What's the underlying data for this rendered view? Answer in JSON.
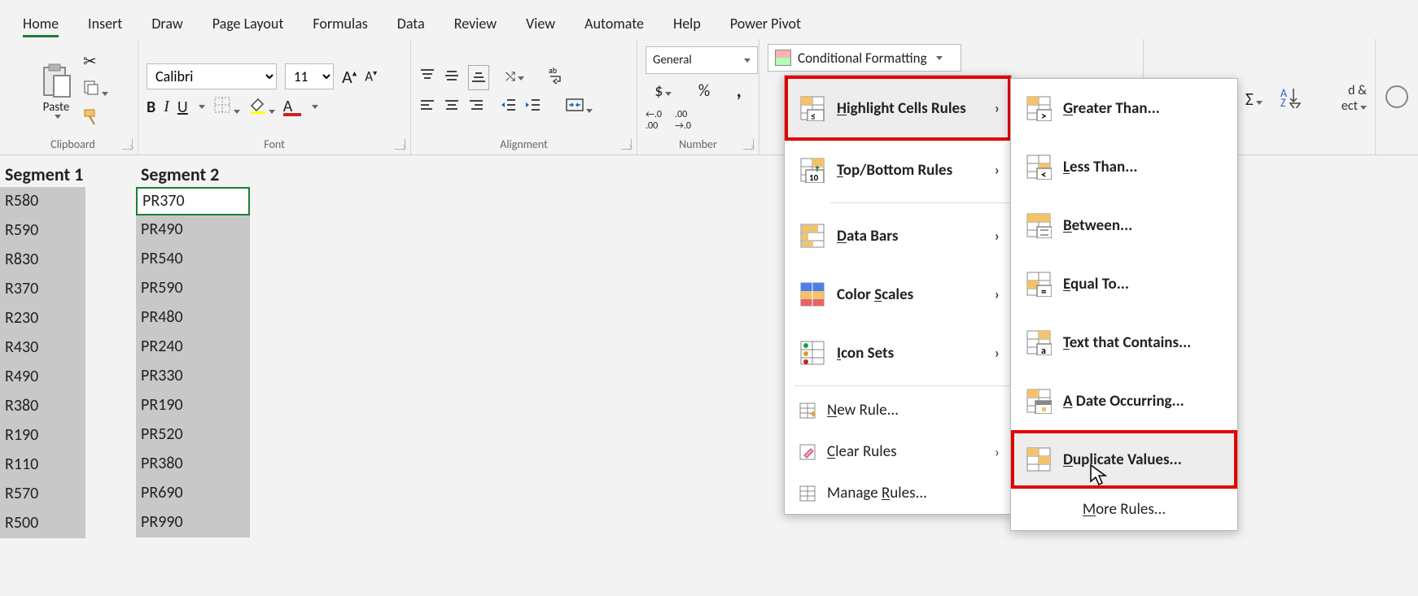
{
  "ribbon": {
    "tabs": [
      "Home",
      "Insert",
      "Draw",
      "Page Layout",
      "Formulas",
      "Data",
      "Review",
      "View",
      "Automate",
      "Help",
      "Power Pivot"
    ],
    "activeTab": "Home",
    "clipboard": {
      "label": "Clipboard",
      "paste": "Paste"
    },
    "font": {
      "label": "Font",
      "name": "Calibri",
      "size": "11",
      "bold": "B",
      "italic": "I",
      "underline": "U",
      "incA": "A",
      "decA": "A"
    },
    "alignment": {
      "label": "Alignment"
    },
    "number": {
      "label": "Number",
      "format": "General",
      "dollar": "$",
      "percent": "%",
      "comma": ",",
      "incDec": ".0",
      "decInc": ".00"
    },
    "condfmt": {
      "label": "Conditional Formatting"
    },
    "insert": "Insert",
    "autosum": "Σ",
    "rightPartial": {
      "a": "d &",
      "b": "ect"
    }
  },
  "sheet": {
    "headers": [
      "Segment 1",
      "Segment 2"
    ],
    "colA": [
      "R580",
      "R590",
      "R830",
      "R370",
      "R230",
      "R430",
      "R490",
      "R380",
      "R190",
      "R110",
      "R570",
      "R500"
    ],
    "colB": [
      "PR370",
      "PR490",
      "PR540",
      "PR590",
      "PR480",
      "PR240",
      "PR330",
      "PR190",
      "PR520",
      "PR380",
      "PR690",
      "PR990"
    ]
  },
  "menu1": {
    "items": [
      {
        "label": "Highlight Cells Rules",
        "sub": true,
        "highlight": true,
        "ak": "H"
      },
      {
        "label": "Top/Bottom Rules",
        "sub": true,
        "ak": "T"
      },
      {
        "label": "Data Bars",
        "sub": true,
        "ak": "D"
      },
      {
        "label": "Color Scales",
        "sub": true,
        "ak": "S"
      },
      {
        "label": "Icon Sets",
        "sub": true,
        "ak": "I"
      },
      {
        "label": "New Rule...",
        "sub": false,
        "ak": "N"
      },
      {
        "label": "Clear Rules",
        "sub": true,
        "ak": "C"
      },
      {
        "label": "Manage Rules...",
        "sub": false,
        "ak": "R"
      }
    ]
  },
  "menu2": {
    "items": [
      {
        "label": "Greater Than...",
        "ak": "G"
      },
      {
        "label": "Less Than...",
        "ak": "L"
      },
      {
        "label": "Between...",
        "ak": "B"
      },
      {
        "label": "Equal To...",
        "ak": "E"
      },
      {
        "label": "Text that Contains...",
        "ak": "T"
      },
      {
        "label": "A Date Occurring...",
        "ak": "A"
      },
      {
        "label": "Duplicate Values...",
        "ak": "D",
        "highlight": true
      },
      {
        "label": "More Rules...",
        "ak": "M",
        "plain": true
      }
    ]
  }
}
